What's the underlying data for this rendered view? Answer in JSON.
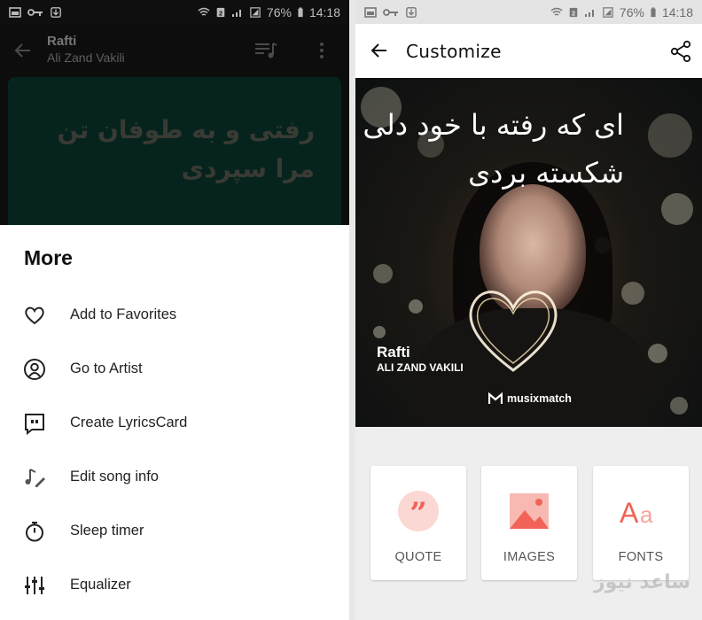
{
  "status_bar": {
    "battery": "76%",
    "time": "14:18"
  },
  "player": {
    "song": "Rafti",
    "artist": "Ali Zand Vakili",
    "lyric": "رفتی و به طوفان تن مرا سپردی"
  },
  "more_menu": {
    "title": "More",
    "items": [
      {
        "label": "Add to Favorites",
        "icon": "heart-outline-icon"
      },
      {
        "label": "Go to Artist",
        "icon": "artist-icon"
      },
      {
        "label": "Create LyricsCard",
        "icon": "quote-card-icon"
      },
      {
        "label": "Edit song info",
        "icon": "music-edit-icon"
      },
      {
        "label": "Sleep timer",
        "icon": "stopwatch-icon"
      },
      {
        "label": "Equalizer",
        "icon": "equalizer-icon"
      }
    ]
  },
  "customize": {
    "title": "Customize",
    "card": {
      "lyric": "ای که رفته با خود دلی شکسته بردی",
      "song": "Rafti",
      "artist": "ALI ZAND VAKILI",
      "brand": "musixmatch"
    },
    "tools": [
      {
        "label": "QUOTE",
        "icon": "quote-icon"
      },
      {
        "label": "IMAGES",
        "icon": "image-icon"
      },
      {
        "label": "FONTS",
        "icon": "font-icon"
      }
    ]
  },
  "colors": {
    "accent": "#f16357",
    "accent_light": "#fbd8d4",
    "dark": "#0c0d0c"
  },
  "watermark": "ساعد نیوز"
}
